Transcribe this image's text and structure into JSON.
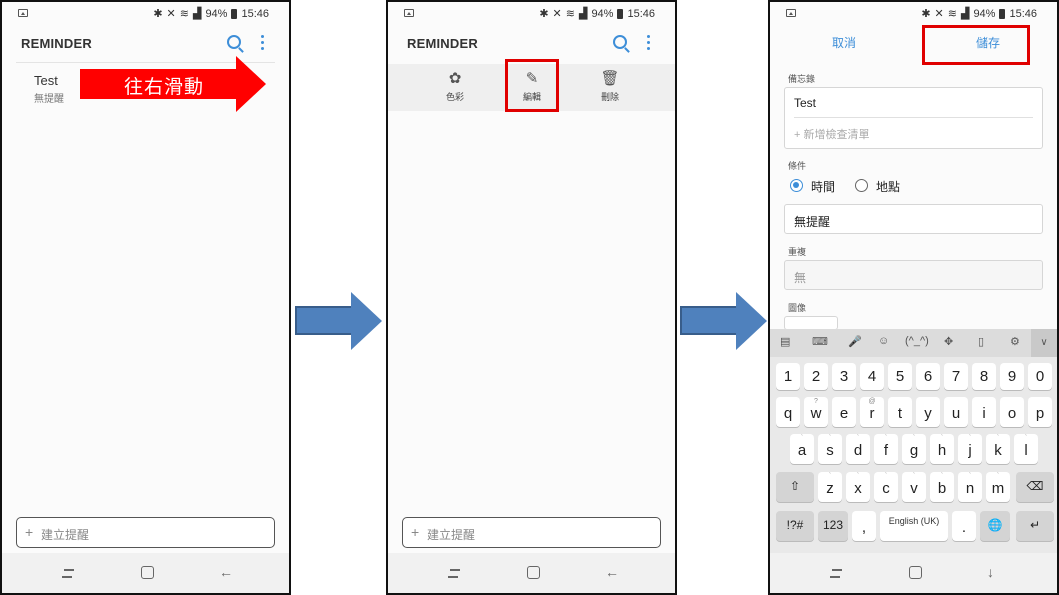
{
  "status_bar": {
    "battery": "94%",
    "time": "15:46"
  },
  "app": {
    "title": "REMINDER"
  },
  "reminder_item": {
    "title": "Test",
    "subtitle": "無提醒"
  },
  "annotation": {
    "swipe_label": "往右滑動"
  },
  "bottom_add": {
    "plus": "+",
    "placeholder": "建立提醒"
  },
  "actions": [
    {
      "label": "色彩",
      "icon": "palette-icon"
    },
    {
      "label": "編輯",
      "icon": "pencil-icon"
    },
    {
      "label": "刪除",
      "icon": "trash-icon"
    }
  ],
  "edit_screen": {
    "cancel_label": "取消",
    "save_label": "儲存",
    "memo_label": "備忘錄",
    "memo_value": "Test",
    "checklist_placeholder": "新增檢查清單",
    "condition_label": "條件",
    "option_time": "時間",
    "option_place": "地點",
    "condition_selected": "時間",
    "reminder_value": "無提醒",
    "repeat_label": "重複",
    "repeat_value": "無",
    "image_label": "圖像"
  },
  "keyboard": {
    "toolbar_items": [
      "clipboard-icon",
      "keyboard-icon",
      "mic-icon",
      "emoji-icon",
      "kaomoji",
      "move-icon",
      "one-hand-icon",
      "settings-icon",
      "collapse-icon"
    ],
    "kaomoji_label": "(^_^)",
    "row_numbers": [
      "1",
      "2",
      "3",
      "4",
      "5",
      "6",
      "7",
      "8",
      "9",
      "0"
    ],
    "row_q": [
      "q",
      "w",
      "e",
      "r",
      "t",
      "y",
      "u",
      "i",
      "o",
      "p"
    ],
    "row_q_hints": [
      "",
      "?",
      "",
      "@",
      "",
      "",
      "",
      "",
      "",
      ""
    ],
    "row_a": [
      "a",
      "s",
      "d",
      "f",
      "g",
      "h",
      "j",
      "k",
      "l"
    ],
    "row_z": [
      "z",
      "x",
      "c",
      "v",
      "b",
      "n",
      "m"
    ],
    "symbols_label": "!?#",
    "numbers_label": "123",
    "comma": ",",
    "space_label": "English (UK)",
    "period": "."
  },
  "colors": {
    "accent": "#3d8ed8",
    "highlight": "#ff0000",
    "flow_arrow": "#4f81bd"
  }
}
